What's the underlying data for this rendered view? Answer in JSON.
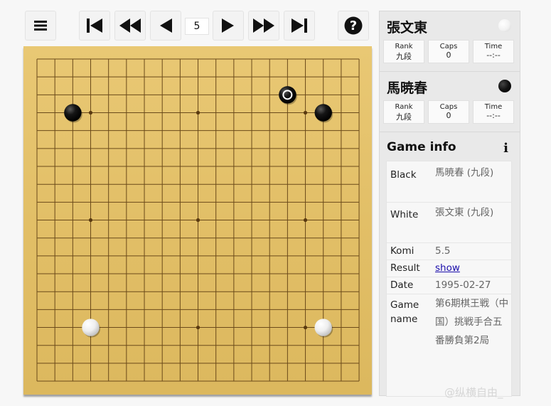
{
  "toolbar": {
    "buttons": [
      {
        "name": "menu-button",
        "icon": "hamburger-icon"
      },
      {
        "name": "first-move-button",
        "icon": "skip-back-icon"
      },
      {
        "name": "fast-back-button",
        "icon": "fast-back-icon"
      },
      {
        "name": "prev-move-button",
        "icon": "prev-icon"
      },
      {
        "name": "next-move-button",
        "icon": "next-icon"
      },
      {
        "name": "fast-forward-button",
        "icon": "fast-forward-icon"
      },
      {
        "name": "last-move-button",
        "icon": "skip-forward-icon"
      },
      {
        "name": "help-button",
        "icon": "question-icon"
      }
    ],
    "move_number": "5"
  },
  "board": {
    "size": 19,
    "colors": {
      "line": "#6b4a1a",
      "hoshi": "#5a3a10"
    },
    "hoshi": [
      [
        3,
        3
      ],
      [
        9,
        3
      ],
      [
        15,
        3
      ],
      [
        3,
        9
      ],
      [
        9,
        9
      ],
      [
        15,
        9
      ],
      [
        3,
        15
      ],
      [
        9,
        15
      ],
      [
        15,
        15
      ]
    ],
    "stones": [
      {
        "color": "black",
        "col": 2,
        "row": 3
      },
      {
        "color": "black",
        "col": 16,
        "row": 3
      },
      {
        "color": "white",
        "col": 3,
        "row": 15
      },
      {
        "color": "white",
        "col": 16,
        "row": 15
      },
      {
        "color": "black",
        "col": 14,
        "row": 2,
        "last_move": true
      }
    ]
  },
  "players": {
    "white": {
      "name": "張文東",
      "stone": "white",
      "rank_label": "Rank",
      "rank": "九段",
      "caps_label": "Caps",
      "caps": "0",
      "time_label": "Time",
      "time": "--:--"
    },
    "black": {
      "name": "馬暁春",
      "stone": "black",
      "rank_label": "Rank",
      "rank": "九段",
      "caps_label": "Caps",
      "caps": "0",
      "time_label": "Time",
      "time": "--:--"
    }
  },
  "game_info": {
    "title": "Game info",
    "icon": "info-icon",
    "rows": [
      {
        "key": "Black",
        "value": "馬暁春 (九段)"
      },
      {
        "key": "White",
        "value": "張文東 (九段)"
      },
      {
        "key": "Komi",
        "value": "5.5"
      },
      {
        "key": "Result",
        "value": "show"
      },
      {
        "key": "Date",
        "value": "1995-02-27"
      },
      {
        "key": "Game name",
        "value": "第6期棋王戦（中国）挑戦手合五番勝負第2局"
      }
    ]
  },
  "watermark": "@纵横自由_"
}
